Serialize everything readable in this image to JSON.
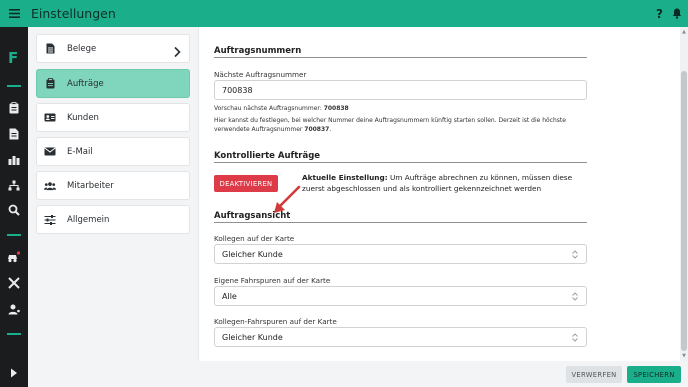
{
  "app": {
    "title": "Einstellungen",
    "help_label": "?"
  },
  "nav": {
    "items": [
      {
        "label": "Belege",
        "icon": "document-icon"
      },
      {
        "label": "Aufträge",
        "icon": "clipboard-icon",
        "active": true
      },
      {
        "label": "Kunden",
        "icon": "id-card-icon"
      },
      {
        "label": "E-Mail",
        "icon": "envelope-icon"
      },
      {
        "label": "Mitarbeiter",
        "icon": "users-icon"
      },
      {
        "label": "Allgemein",
        "icon": "sliders-icon"
      }
    ]
  },
  "orders": {
    "title": "Auftragsnummern",
    "next_label": "Nächste Auftragsnummer",
    "next_value": "700838",
    "preview_prefix": "Vorschau nächste Auftragsnummer:",
    "preview_value": "700838",
    "hint_text": "Hier kannst du festlegen, bei welcher Nummer deine Auftragsnummern künftig starten sollen. Derzeit ist die höchste verwendete Auftragsnummer",
    "hint_value": "700837"
  },
  "controlled": {
    "title": "Kontrollierte Aufträge",
    "button_label": "DEAKTIVIEREN",
    "current_label": "Aktuelle Einstellung:",
    "current_text": "Um Aufträge abrechnen zu können, müssen diese zuerst abgeschlossen und als kontrolliert gekennzeichnet werden"
  },
  "view": {
    "title": "Auftragsansicht",
    "fields": [
      {
        "label": "Kollegen auf der Karte",
        "value": "Gleicher Kunde"
      },
      {
        "label": "Eigene Fahrspuren auf der Karte",
        "value": "Alle"
      },
      {
        "label": "Kollegen-Fahrspuren auf der Karte",
        "value": "Gleicher Kunde"
      }
    ]
  },
  "footer": {
    "discard_label": "VERWERFEN",
    "save_label": "SPEICHERN"
  },
  "colors": {
    "accent": "#1aae8a",
    "active_nav": "#7fd6bd",
    "danger": "#de3b48",
    "rail": "#1b1c1e"
  }
}
